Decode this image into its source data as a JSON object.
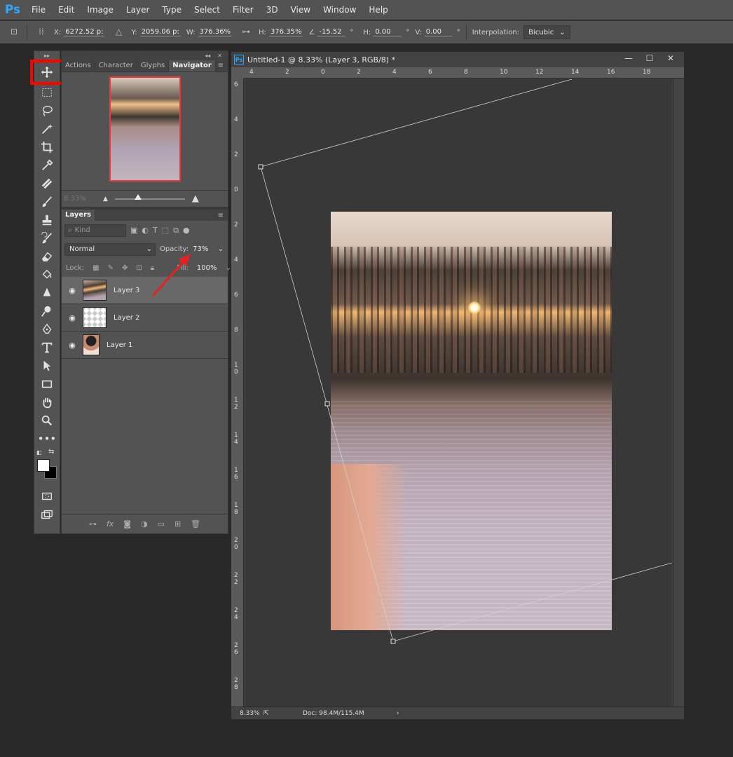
{
  "app": {
    "logo": "Ps",
    "menu": [
      "File",
      "Edit",
      "Image",
      "Layer",
      "Type",
      "Select",
      "Filter",
      "3D",
      "View",
      "Window",
      "Help"
    ]
  },
  "options": {
    "x_label": "X:",
    "x_value": "6272.52 p:",
    "y_label": "Y:",
    "y_value": "2059.06 p:",
    "w_label": "W:",
    "w_value": "376.36%",
    "h_label": "H:",
    "h_value": "376.35%",
    "angle_value": "-15.52",
    "angle_unit": "°",
    "hskew_label": "H:",
    "hskew_value": "0.00",
    "hskew_unit": "°",
    "vskew_label": "V:",
    "vskew_value": "0.00",
    "vskew_unit": "°",
    "interp_label": "Interpolation:",
    "interp_value": "Bicubic"
  },
  "navigator": {
    "tabs": [
      "Actions",
      "Character",
      "Glyphs",
      "Navigator"
    ],
    "zoom": "8.33%"
  },
  "layers": {
    "tab": "Layers",
    "kind_placeholder": "Kind",
    "blend_mode": "Normal",
    "opacity_label": "Opacity:",
    "opacity_value": "73%",
    "lock_label": "Lock:",
    "fill_label": "Fill:",
    "fill_value": "100%",
    "items": [
      {
        "name": "Layer 3",
        "selected": true
      },
      {
        "name": "Layer 2",
        "selected": false
      },
      {
        "name": "Layer 1",
        "selected": false
      }
    ]
  },
  "document": {
    "title": "Untitled-1 @ 8.33% (Layer 3, RGB/8) *",
    "ps_badge": "Ps",
    "ruler_top": [
      "4",
      "2",
      "0",
      "2",
      "4",
      "6",
      "8",
      "10",
      "12",
      "14",
      "16",
      "18"
    ],
    "ruler_left": [
      "6",
      "4",
      "2",
      "0",
      "2",
      "4",
      "6",
      "8",
      "10",
      "12",
      "14",
      "16",
      "18",
      "20",
      "22",
      "24",
      "26",
      "28"
    ],
    "status_zoom": "8.33%",
    "status_doc": "Doc: 98.4M/115.4M"
  },
  "colors": {
    "accent_blue": "#31a8ff",
    "highlight_red": "#ff0000",
    "panel_bg": "#535353",
    "canvas_bg": "#383838"
  }
}
